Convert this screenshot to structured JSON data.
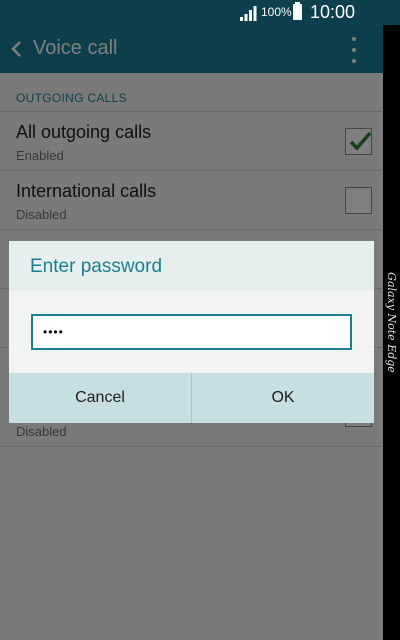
{
  "status_bar": {
    "battery_percent": "100%",
    "time": "10:00",
    "icons": [
      "signal-icon",
      "battery-icon"
    ]
  },
  "action_bar": {
    "title": "Voice call",
    "icons": [
      "back-arrow-icon",
      "more-options-icon"
    ]
  },
  "list": {
    "section_header": "OUTGOING CALLS",
    "items": [
      {
        "title": "All outgoing calls",
        "subtitle": "Enabled",
        "checked": true
      },
      {
        "title": "International calls",
        "subtitle": "Disabled",
        "checked": false
      },
      {
        "title": "",
        "subtitle": "Disabled",
        "checked": false
      }
    ]
  },
  "dialog": {
    "title": "Enter password",
    "password_value": "••••",
    "cancel_label": "Cancel",
    "ok_label": "OK"
  },
  "device": {
    "edge_label": "Galaxy Note Edge"
  },
  "colors": {
    "status_bar": "#0d3f4c",
    "action_bar": "#1b7f94",
    "accent": "#1b7f94",
    "check_mark": "#2e7d32"
  }
}
